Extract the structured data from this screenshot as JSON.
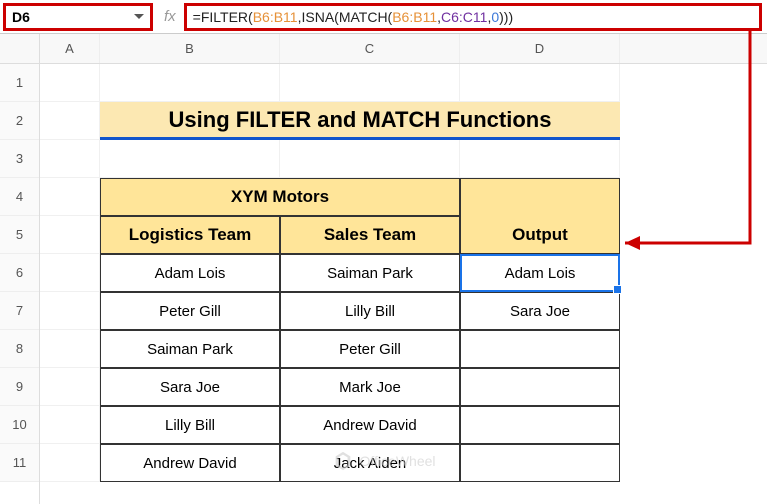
{
  "nameBox": "D6",
  "fx": "fx",
  "formula": {
    "p1": "=FILTER(",
    "r1": "B6:B11",
    "p2": ",ISNA(MATCH(",
    "r2": "B6:B11",
    "p3": ",",
    "r3": "C6:C11",
    "p4": ",",
    "zero": "0",
    "p5": ")))"
  },
  "cols": {
    "A": "A",
    "B": "B",
    "C": "C",
    "D": "D"
  },
  "rows": {
    "1": "1",
    "2": "2",
    "3": "3",
    "4": "4",
    "5": "5",
    "6": "6",
    "7": "7",
    "8": "8",
    "9": "9",
    "10": "10",
    "11": "11"
  },
  "title": "Using FILTER and MATCH Functions",
  "headers": {
    "merged": "XYM Motors",
    "b": "Logistics Team",
    "c": "Sales Team",
    "d": "Output"
  },
  "dataB": [
    "Adam Lois",
    "Peter Gill",
    "Saiman Park",
    "Sara Joe",
    "Lilly Bill",
    "Andrew David"
  ],
  "dataC": [
    "Saiman Park",
    "Lilly Bill",
    "Peter Gill",
    "Mark Joe",
    "Andrew David",
    "Jack Aiden"
  ],
  "dataD": [
    "Adam Lois",
    "Sara Joe",
    "",
    "",
    "",
    ""
  ],
  "watermark": "OfficeWheel",
  "chart_data": {
    "type": "table",
    "title": "Using FILTER and MATCH Functions",
    "columns": [
      "Logistics Team",
      "Sales Team",
      "Output"
    ],
    "rows": [
      [
        "Adam Lois",
        "Saiman Park",
        "Adam Lois"
      ],
      [
        "Peter Gill",
        "Lilly Bill",
        "Sara Joe"
      ],
      [
        "Saiman Park",
        "Peter Gill",
        ""
      ],
      [
        "Sara Joe",
        "Mark Joe",
        ""
      ],
      [
        "Lilly Bill",
        "Andrew David",
        ""
      ],
      [
        "Andrew David",
        "Jack Aiden",
        ""
      ]
    ]
  }
}
